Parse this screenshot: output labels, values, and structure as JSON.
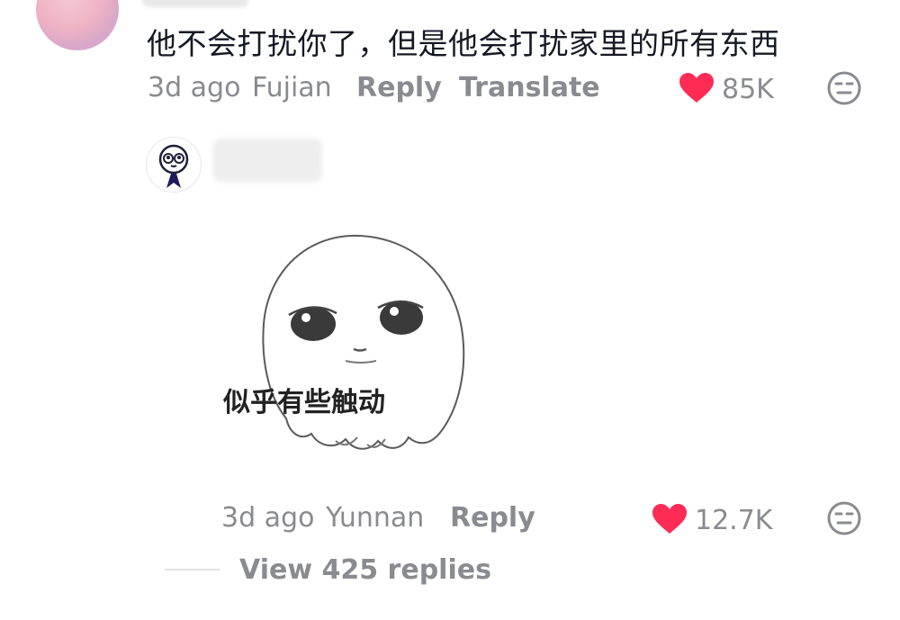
{
  "comment1": {
    "text": "他不会打扰你了，但是他会打扰家里的所有东西",
    "time": "3d ago",
    "location": "Fujian",
    "reply_label": "Reply",
    "translate_label": "Translate",
    "likes": "85K"
  },
  "comment2": {
    "sticker_caption": "似乎有些触动",
    "time": "3d ago",
    "location": "Yunnan",
    "reply_label": "Reply",
    "likes": "12.7K"
  },
  "view_replies": "View 425 replies",
  "colors": {
    "heart": "#fe2c55",
    "text": "#161823",
    "muted": "#8a8b91"
  },
  "icons": [
    "heart-icon",
    "neutral-face-icon"
  ]
}
